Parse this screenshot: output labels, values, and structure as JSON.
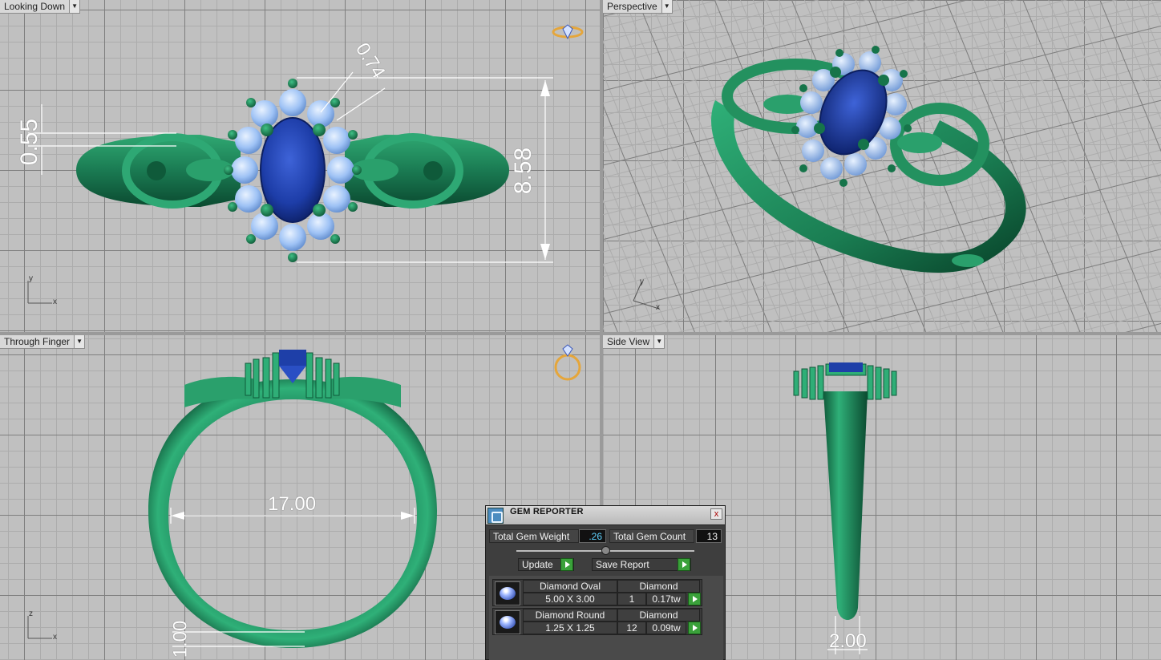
{
  "viewports": {
    "top": {
      "label": "Looking Down",
      "dims": {
        "width_top": "0.74",
        "height": "8.58",
        "band": "0.55"
      }
    },
    "perspective": {
      "label": "Perspective"
    },
    "front": {
      "label": "Through Finger",
      "dims": {
        "inner_diameter": "17.00",
        "thickness": "1.00"
      }
    },
    "side": {
      "label": "Side View",
      "dims": {
        "width": "2.00"
      }
    }
  },
  "axes": {
    "y": "y",
    "x": "x",
    "z": "z"
  },
  "icons": {
    "dropdown": "chevron-down-icon",
    "gem_view": "gem-ring-icon",
    "close": "close-icon",
    "play": "play-icon"
  },
  "colors": {
    "ring_green": "#1f8a5e",
    "gem_blue": "#1e3fa8",
    "accent_diamond": "#a9c8ff",
    "gem_icon_gold": "#e5a63b"
  },
  "gem_reporter": {
    "title": "GEM REPORTER",
    "close_label": "x",
    "total_weight_label": "Total Gem Weight",
    "total_weight_value": ".26",
    "total_count_label": "Total Gem Count",
    "total_count_value": "13",
    "update_label": "Update",
    "save_report_label": "Save Report",
    "gems": [
      {
        "name": "Diamond Oval",
        "material": "Diamond",
        "size": "5.00 X 3.00",
        "count": "1",
        "weight": "0.17tw"
      },
      {
        "name": "Diamond Round",
        "material": "Diamond",
        "size": "1.25 X 1.25",
        "count": "12",
        "weight": "0.09tw"
      }
    ]
  }
}
